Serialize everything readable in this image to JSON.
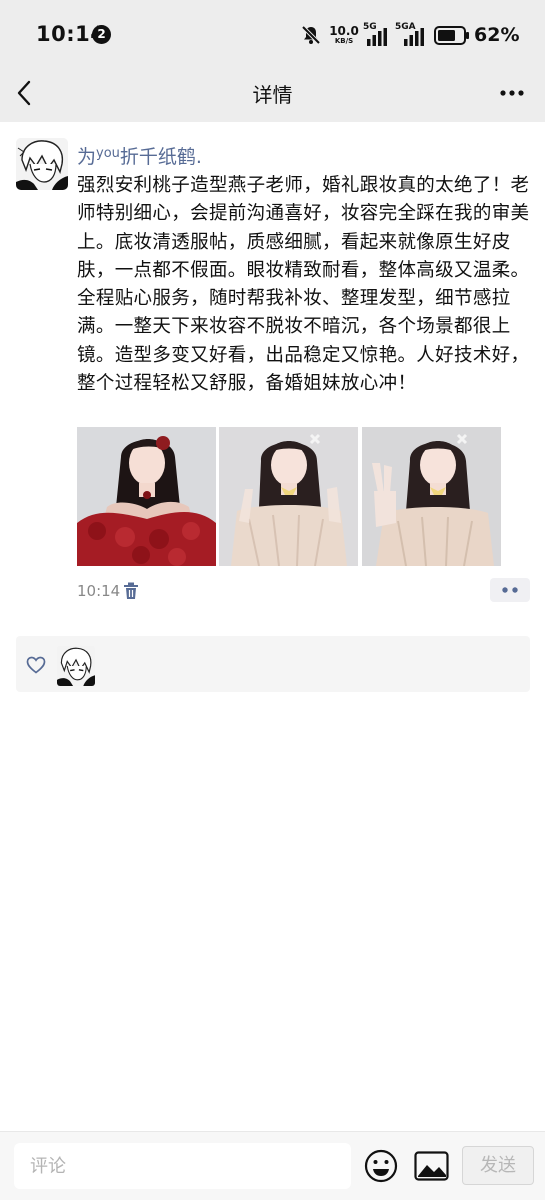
{
  "status_bar": {
    "time": "10:14",
    "notification_count": "2",
    "net_speed_value": "10.0",
    "net_speed_unit": "KB/S",
    "signal_1_label": "5G",
    "signal_2_label": "5GA",
    "battery_percent": "62%"
  },
  "nav": {
    "title": "详情",
    "back_icon": "chevron-left-icon",
    "more_icon": "more-dots-icon"
  },
  "post": {
    "author_prefix": "为",
    "author_sup": "you",
    "author_suffix": "折千纸鹤.",
    "text": "强烈安利桃子造型燕子老师，婚礼跟妆真的太绝了！老师特别细心，会提前沟通喜好，妆容完全踩在我的审美上。底妆清透服帖，质感细腻，看起来就像原生好皮肤，一点都不假面。眼妆精致耐看，整体高级又温柔。全程贴心服务，随时帮我补妆、整理发型，细节感拉满。一整天下来妆容不脱妆不暗沉，各个场景都很上镜。造型多变又好看，出品稳定又惊艳。人好技术好，整个过程轻松又舒服，备婚姐妹放心冲！",
    "time": "10:14",
    "photos": [
      {
        "name": "photo-red-gown",
        "dress_color": "#a51c24"
      },
      {
        "name": "photo-cream-gown-ok",
        "dress_color": "#ead9cc"
      },
      {
        "name": "photo-cream-gown-peace",
        "dress_color": "#e9d6c8"
      }
    ]
  },
  "comment_bar": {
    "placeholder": "评论",
    "send_label": "发送"
  },
  "colors": {
    "author_link": "#576b95",
    "header_bg": "#ededed",
    "panel_bg": "#f5f5f5"
  }
}
